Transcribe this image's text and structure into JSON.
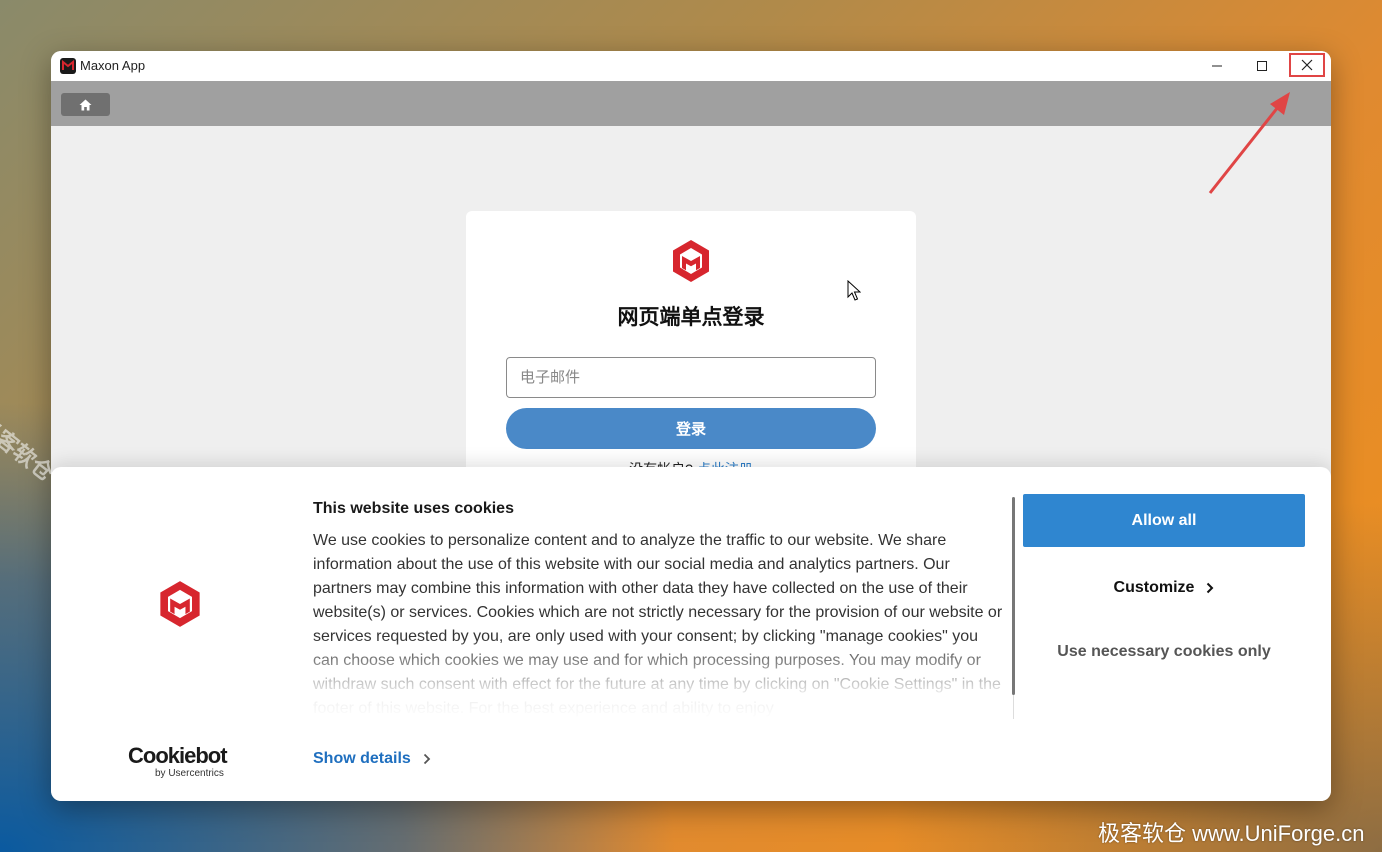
{
  "window": {
    "title": "Maxon App",
    "controls": {
      "minimize": "minimize",
      "maximize": "maximize",
      "close": "close"
    }
  },
  "toolbar": {
    "home_icon": "home-icon"
  },
  "login": {
    "title": "网页端单点登录",
    "email_placeholder": "电子邮件",
    "submit_label": "登录",
    "no_account_text": "没有帐户?",
    "register_link": "点此注册"
  },
  "cookie_banner": {
    "title": "This website uses cookies",
    "body": "We use cookies to personalize content and to analyze the traffic to our website. We share information about the use of this website with our social media and analytics partners. Our partners may combine this information with other data they have collected on the use of their website(s) or services. Cookies which are not strictly necessary for the provision of our website or services requested by you, are only used with your consent;  by clicking \"manage cookies\" you can choose which cookies we may use and for which processing purposes. You may modify or withdraw such consent with effect for the future at any time by clicking on \"Cookie Settings\" in the footer of this website. For the best experience and ability to enjoy",
    "show_details": "Show details",
    "allow_all": "Allow all",
    "customize": "Customize",
    "necessary_only": "Use necessary cookies only",
    "provider_name": "Cookiebot",
    "provider_sub": "by Usercentrics"
  },
  "watermarks": {
    "diagonal": "极客软仓 UniForge.cn",
    "corner": "极客软仓 www.UniForge.cn"
  },
  "colors": {
    "brand_red": "#d7262e",
    "allow_blue": "#2f86d0",
    "login_blue": "#4a89c8",
    "link_blue": "#1f6fbf",
    "annotation_red": "#e04545"
  }
}
